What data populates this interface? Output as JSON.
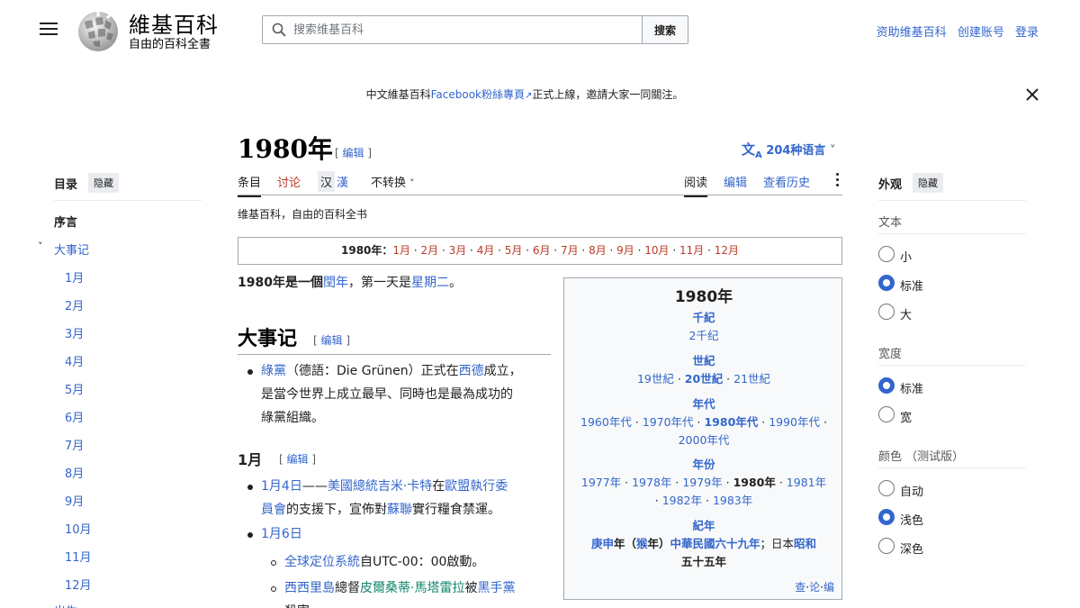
{
  "header": {
    "logo_title": "維基百科",
    "logo_subtitle": "自由的百科全書",
    "search_placeholder": "搜索维基百科",
    "search_button": "搜索",
    "links": [
      "资助维基百科",
      "创建账号",
      "登录"
    ]
  },
  "notice": {
    "prefix": "中文維基百科",
    "link": "Facebook粉絲專頁",
    "suffix": "正式上線，邀請大家一同關注。"
  },
  "toc": {
    "title": "目录",
    "hide": "隐藏",
    "items": [
      "序言",
      "大事记",
      "1月",
      "2月",
      "3月",
      "4月",
      "5月",
      "6月",
      "7月",
      "8月",
      "9月",
      "10月",
      "11月",
      "12月",
      "出生"
    ]
  },
  "article": {
    "title": "1980年",
    "edit_label": "编辑",
    "languages": "204种语言",
    "tabs": {
      "article": "条目",
      "talk": "讨论",
      "variant_trad": "汉",
      "variant_simp": "漢",
      "convert": "不转换",
      "read": "阅读",
      "edit": "编辑",
      "history": "查看历史"
    },
    "tagline": "维基百科，自由的百科全书",
    "monthbar": {
      "label": "1980年：",
      "months": [
        "1月",
        "2月",
        "3月",
        "4月",
        "5月",
        "6月",
        "7月",
        "8月",
        "9月",
        "10月",
        "11月",
        "12月"
      ]
    },
    "intro": {
      "t1": "1980年是一個",
      "link1": "閏年",
      "t2": "，第一天是",
      "link2": "星期二",
      "t3": "。"
    },
    "section_events": "大事记",
    "event1": {
      "link1": "綠黨",
      "t1": "（德語：Die Grünen）正式在",
      "link2": "西德",
      "t2": "成立，",
      "line2": "是當今世界上成立最早、同時也是最為成功的",
      "line3": "綠黨組織。"
    },
    "section_jan": "1月",
    "jan4": {
      "date": "1月4日",
      "dash": "——",
      "link1": "美國總統",
      "link2": "吉米·卡特",
      "t1": "在",
      "link3": "歐盟執行委",
      "link3b": "員會",
      "t2": "的支援下，宣佈對",
      "link4": "蘇聯",
      "t3": "實行糧食禁運。"
    },
    "jan6": {
      "date": "1月6日",
      "sub1_link": "全球定位系統",
      "sub1_text": "自UTC-00：00啟動。",
      "sub2_link1": "西西里島",
      "sub2_t1": "總督",
      "sub2_link2": "皮爾桑蒂·馬塔雷拉",
      "sub2_t2": "被",
      "sub2_link3": "黑手黨",
      "sub2_cut": "殺害"
    }
  },
  "infobox": {
    "title": "1980年",
    "millennium_head": "千紀",
    "millennium": "2千纪",
    "century_head": "世紀",
    "centuries": [
      "19世紀",
      "20世紀",
      "21世紀"
    ],
    "decade_head": "年代",
    "decades_line1": [
      "1960年代",
      "1970年代",
      "1980年代",
      "1990年代"
    ],
    "decades_line2": "2000年代",
    "year_head": "年份",
    "years_line1": [
      "1977年",
      "1978年",
      "1979年",
      "1980年",
      "1981年"
    ],
    "years_line2": [
      "1982年",
      "1983年"
    ],
    "era_head": "紀年",
    "era_ganzhi": "庚申",
    "era_nian": "年（",
    "era_monkey": "猴",
    "era_nian2": "年）",
    "era_roc": "中華民國",
    "era_roc_year": "六十九年",
    "era_japan": "；日本",
    "era_showa": "昭和",
    "era_showa_year": "五十五年",
    "footer": [
      "查",
      "论",
      "编"
    ]
  },
  "appearance": {
    "title": "外观",
    "hide": "隐藏",
    "text_label": "文本",
    "text_options": [
      "小",
      "标准",
      "大"
    ],
    "text_selected": 1,
    "width_label": "宽度",
    "width_options": [
      "标准",
      "宽"
    ],
    "width_selected": 0,
    "color_label": "颜色 （测试版）",
    "color_options": [
      "自动",
      "浅色",
      "深色"
    ],
    "color_selected": 1
  },
  "colors": {
    "link": "#3366cc",
    "red_link": "#ba3b28",
    "green_link": "#14866d",
    "border": "#a2a9b1"
  }
}
